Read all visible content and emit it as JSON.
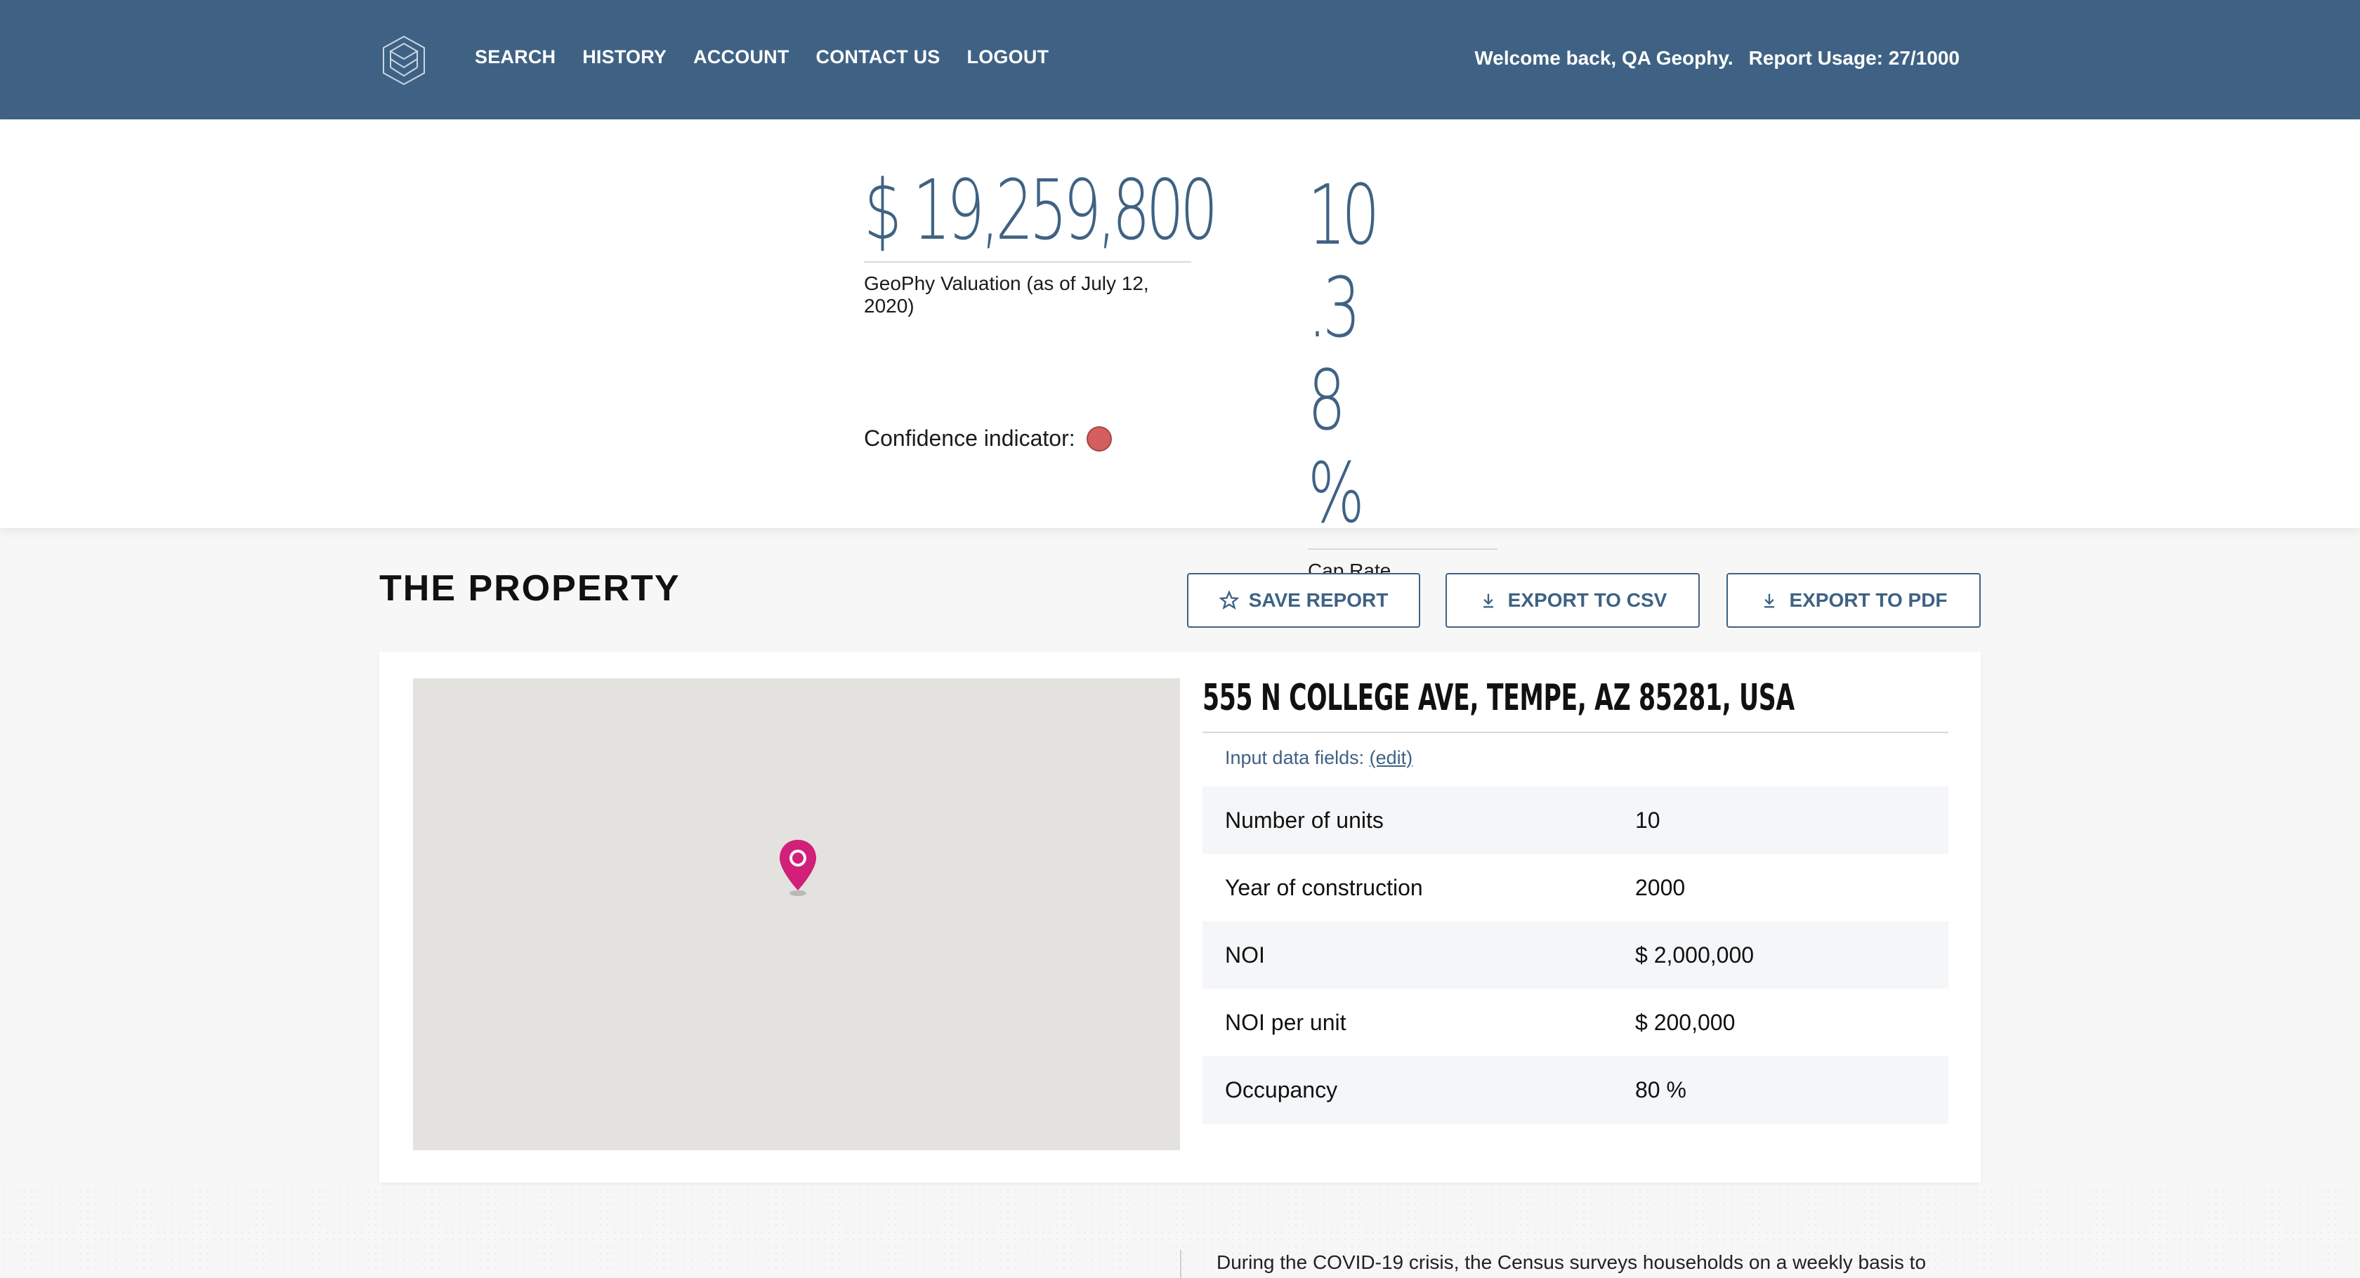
{
  "header": {
    "nav": [
      "SEARCH",
      "HISTORY",
      "ACCOUNT",
      "CONTACT US",
      "LOGOUT"
    ],
    "welcome": "Welcome back, QA Geophy.",
    "usage": "Report Usage: 27/1000"
  },
  "valuation": {
    "value": "$ 19,259,800",
    "value_caption": "GeoPhy Valuation (as of July 12, 2020)",
    "cap_rate": "10.38 %",
    "cap_caption": "Cap Rate",
    "confidence_label": "Confidence indicator:",
    "confidence_color": "#d35f5f"
  },
  "property": {
    "title": "THE PROPERTY",
    "buttons": {
      "save": "SAVE REPORT",
      "csv": "EXPORT TO CSV",
      "pdf": "EXPORT TO PDF"
    },
    "address": "555 N COLLEGE AVE, TEMPE, AZ 85281, USA",
    "input_label": "Input data fields:",
    "edit_label": "(edit)",
    "rows": [
      {
        "label": "Number of units",
        "value": "10"
      },
      {
        "label": "Year of construction",
        "value": "2000"
      },
      {
        "label": "NOI",
        "value": "$ 2,000,000"
      },
      {
        "label": "NOI per unit",
        "value": "$ 200,000"
      },
      {
        "label": "Occupancy",
        "value": "80 %"
      }
    ],
    "pin_color": "#d11f7a"
  },
  "footer_text": "During the COVID-19 crisis, the Census surveys households on a weekly basis to"
}
